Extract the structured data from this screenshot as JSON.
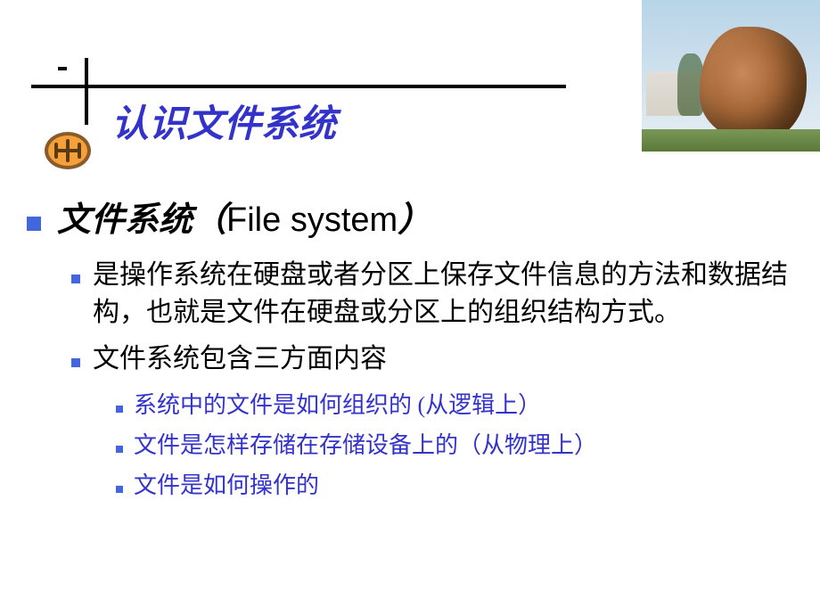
{
  "title": "认识文件系统",
  "level1": {
    "heading_cn": "文件系统",
    "heading_paren_open": "（",
    "heading_en": "File system",
    "heading_paren_close": "）"
  },
  "level2": [
    "是操作系统在硬盘或者分区上保存文件信息的方法和数据结构，也就是文件在硬盘或分区上的组织结构方式。",
    "文件系统包含三方面内容"
  ],
  "level3": [
    "系统中的文件是如何组织的 (从逻辑上）",
    "文件是怎样存储在存储设备上的（从物理上）",
    "文件是如何操作的"
  ]
}
